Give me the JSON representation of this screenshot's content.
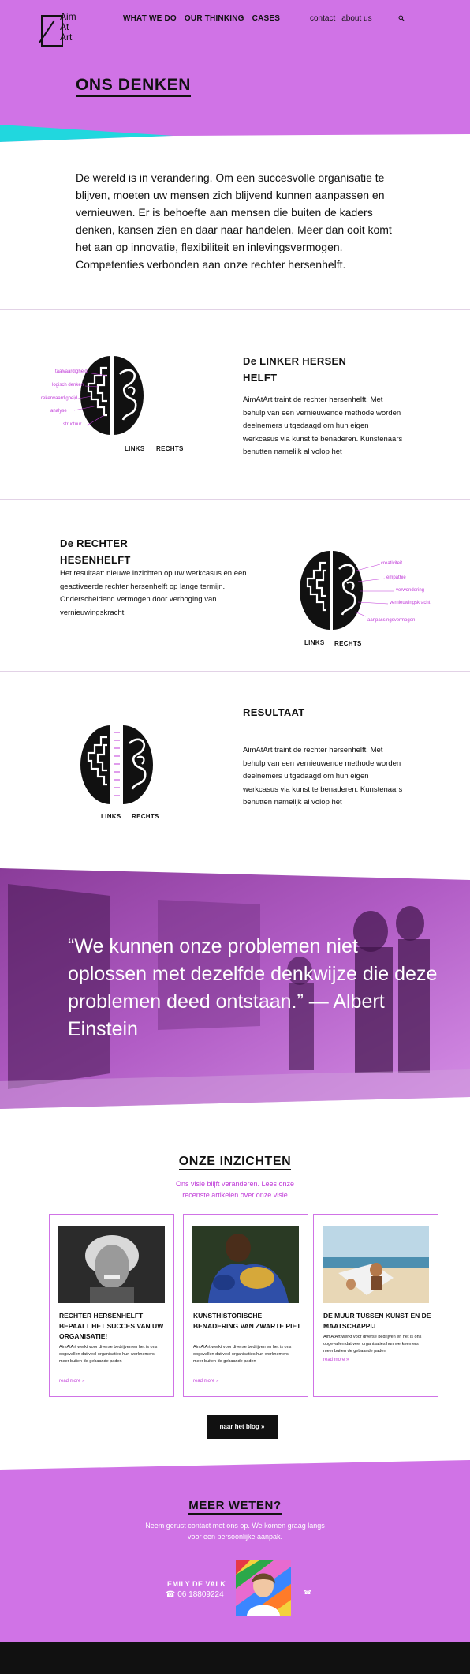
{
  "header": {
    "logo_lines": [
      "Aim",
      "At",
      "Art"
    ],
    "nav_main": [
      "WHAT WE DO",
      "OUR THINKING",
      "CASES"
    ],
    "nav_side": [
      "contact",
      "about us"
    ]
  },
  "hero": {
    "title": "ONS DENKEN"
  },
  "intro": {
    "text": "De wereld is in verandering. Om een succesvolle organisatie te blijven, moeten uw mensen zich blijvend kunnen aanpassen en vernieuwen. Er is behoefte aan mensen die buiten de kaders denken, kansen zien en daar naar handelen. Meer dan ooit komt het aan op innovatie, flexibiliteit en inlevingsvermo­gen. Competenties verbonden aan onze rechter hersenhelft."
  },
  "section1": {
    "title": "De LINKER HERSEN HELFT",
    "text": "AimAtArt traint de rechter hersenhelft. Met behulp van een vernieuwende methode worden deelnemers uitgedaagd om hun eigen werkcasus via kunst te benaderen. Kunste­naars benutten namelijk al volop het",
    "label_left": "LINKS",
    "label_right": "RECHTS",
    "pink_labels": [
      "taalvaardigheid",
      "logisch denken",
      "rekenvaardigheid",
      "analyse",
      "structuur"
    ]
  },
  "section2": {
    "title": "De RECHTER HESENHELFT",
    "text": "Het resultaat: nieuwe inzichten op uw werkcasus en een geactiveerde rechter hersenhelft op lange termijn.  Onderscheidend vermogen door verhoging van vernieuwingskracht",
    "label_left": "LINKS",
    "label_right": "RECHTS",
    "pink_labels": [
      "creativiteit",
      "empathie",
      "verwondering",
      "vernieuwingskracht",
      "aanpassingsvermogen"
    ]
  },
  "section3": {
    "title": "RESULTAAT",
    "text": "AimAtArt traint de rechter hersenhelft. Met behulp van een vernieuwende methode worden deelnemers uitgedaagd om hun eigen werkcasus via kunst te benaderen. Kunste­naars benutten namelijk al volop het",
    "label_left": "LINKS",
    "label_right": "RECHTS"
  },
  "quote": {
    "text": "“We kunnen onze problemen niet oplossen met dezelfde denkwijze die deze problemen deed ontstaan.” — Albert Einstein"
  },
  "insights": {
    "title": "ONZE INZICHTEN",
    "subtitle": "Ons visie blijft veranderen. Lees onze recenste artikelen over onze visie",
    "cards": [
      {
        "title": "RECHTER HERSENHELFT BEPAALT HET SUCCES VAN UW ORGANISATIE!",
        "text": "AimAtArt werkt voor diverse bedrijven en het is ons opgevallen dat veel organisaties hun werknemers meer buiten de gebaande paden",
        "more": "read more »"
      },
      {
        "title": "KUNSTHISTORISCHE BENADERING VAN ZWARTE PIET",
        "text": "AimAtArt werkt voor diverse bedrijven en het is ons opgevallen dat veel organisaties hun werknemers meer buiten de gebaande paden",
        "more": "read more »"
      },
      {
        "title": "DE MUUR TUSSEN KUNST EN DE MAATSCHAPPIJ",
        "text": "AimAtArt werkt voor diverse bedrijven en het is ons opgevallen dat veel organisaties hun werknemers meer buiten de gebaande paden",
        "more": "read more »"
      }
    ],
    "blog_button": "naar het blog »"
  },
  "footer": {
    "title": "MEER WETEN?",
    "subtitle": "Neem gerust contact met ons op. We komen graag langs voor een persoonlijke aanpak.",
    "contact_name": "EMILY DE VALK",
    "contact_phone": "☎ 06 18809224",
    "phone_icon": "☎"
  },
  "colors": {
    "accent": "#d073e6",
    "cyan": "#21d7de",
    "pink_text": "#c03bd8",
    "dark": "#111111"
  }
}
